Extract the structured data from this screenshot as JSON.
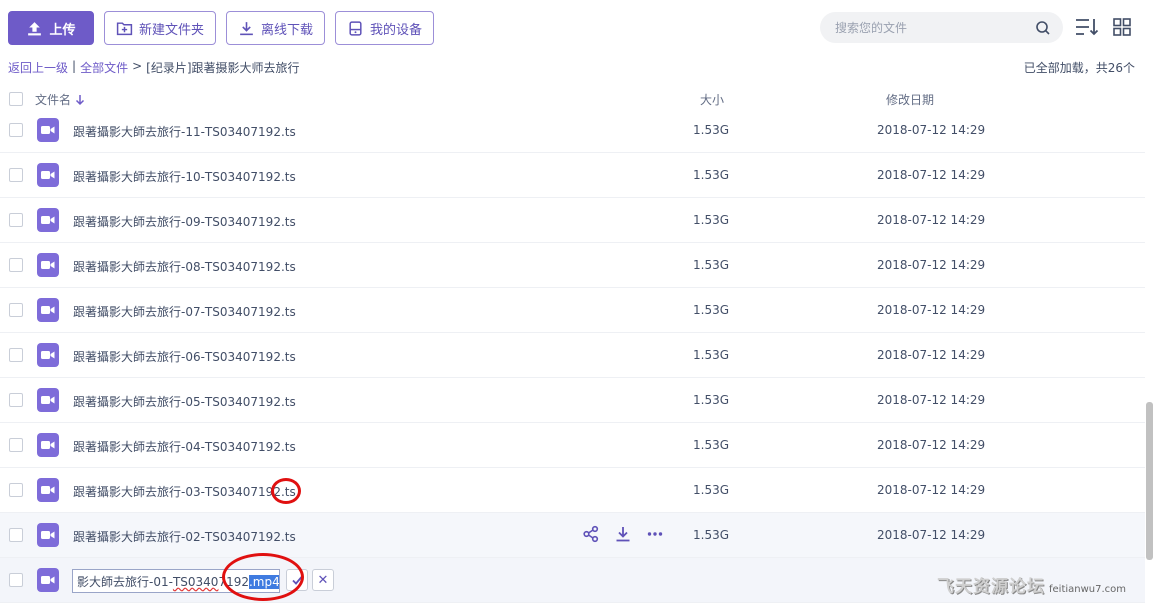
{
  "toolbar": {
    "upload": "上传",
    "new_folder": "新建文件夹",
    "offline_download": "离线下载",
    "my_devices": "我的设备"
  },
  "search": {
    "placeholder": "搜索您的文件"
  },
  "breadcrumb": {
    "back": "返回上一级",
    "sep1": "|",
    "all_files": "全部文件",
    "sep2": ">",
    "current": "[纪录片]跟著摄影大师去旅行"
  },
  "status": {
    "loaded": "已全部加载，共26个"
  },
  "table": {
    "col_name": "文件名",
    "col_size": "大小",
    "col_date": "修改日期"
  },
  "files": [
    {
      "name": "跟著攝影大師去旅行-11-TS03407192.ts",
      "size": "1.53G",
      "date": "2018-07-12 14:29"
    },
    {
      "name": "跟著攝影大師去旅行-10-TS03407192.ts",
      "size": "1.53G",
      "date": "2018-07-12 14:29"
    },
    {
      "name": "跟著攝影大師去旅行-09-TS03407192.ts",
      "size": "1.53G",
      "date": "2018-07-12 14:29"
    },
    {
      "name": "跟著攝影大師去旅行-08-TS03407192.ts",
      "size": "1.53G",
      "date": "2018-07-12 14:29"
    },
    {
      "name": "跟著攝影大師去旅行-07-TS03407192.ts",
      "size": "1.53G",
      "date": "2018-07-12 14:29"
    },
    {
      "name": "跟著攝影大師去旅行-06-TS03407192.ts",
      "size": "1.53G",
      "date": "2018-07-12 14:29"
    },
    {
      "name": "跟著攝影大師去旅行-05-TS03407192.ts",
      "size": "1.53G",
      "date": "2018-07-12 14:29"
    },
    {
      "name": "跟著攝影大師去旅行-04-TS03407192.ts",
      "size": "1.53G",
      "date": "2018-07-12 14:29"
    },
    {
      "name": "跟著攝影大師去旅行-03-TS03407192.ts",
      "size": "1.53G",
      "date": "2018-07-12 14:29"
    },
    {
      "name": "跟著攝影大師去旅行-02-TS03407192.ts",
      "size": "1.53G",
      "date": "2018-07-12 14:29"
    }
  ],
  "edit_row": {
    "prefix": "影大師去旅行-01-",
    "underlined": "TS0340",
    "middle": "7192",
    "selected": ".mp4",
    "cancel": "✕"
  },
  "watermark": {
    "text": "飞天资源论坛",
    "domain": "feitianwu7.com"
  },
  "colors": {
    "accent": "#6e5bc8",
    "annotation": "#e01010"
  },
  "icons": [
    "upload-icon",
    "folder-plus-icon",
    "download-icon",
    "device-icon",
    "search-icon",
    "sort-icon",
    "grid-icon",
    "video-file-icon",
    "share-icon",
    "more-icon",
    "check-icon",
    "close-icon"
  ]
}
